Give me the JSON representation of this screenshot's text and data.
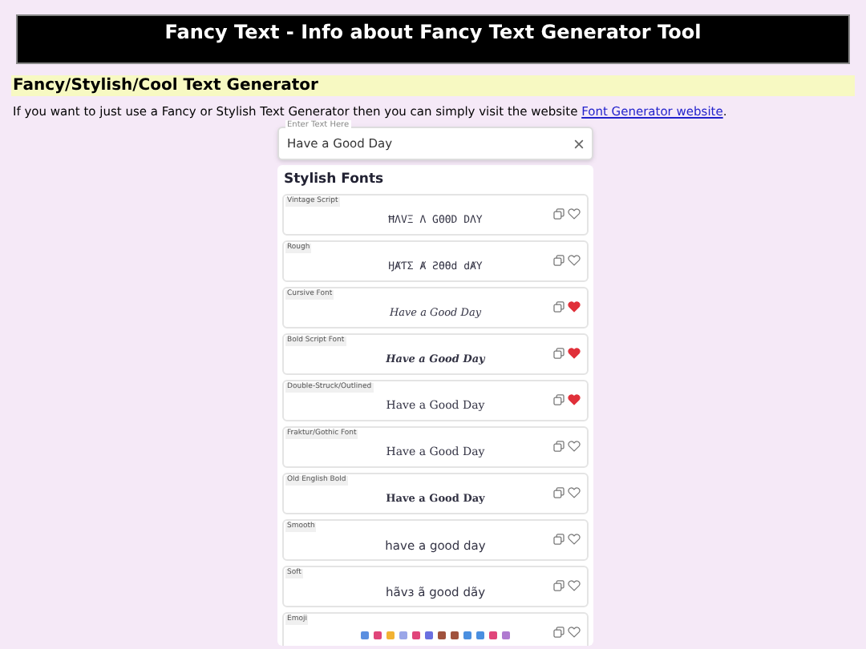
{
  "banner": {
    "title": "Fancy Text - Info about Fancy Text Generator Tool"
  },
  "heading": "Fancy/Stylish/Cool Text Generator",
  "intro": {
    "text": "If you want to just use a Fancy or Stylish Text Generator then you can simply visit the website ",
    "link": "Font Generator website",
    "after": "."
  },
  "input": {
    "label": "Enter Text Here",
    "value": "Have a Good Day"
  },
  "section_title": "Stylish Fonts",
  "fonts": [
    {
      "name": "Vintage Script",
      "kind": "caps",
      "sample": "ĦΛVΞ Λ GΘΘD DΛY",
      "favorite": false
    },
    {
      "name": "Rough",
      "kind": "caps",
      "sample": "ӇȺƬΣ Ⱥ ƧӨӨd dȺY",
      "favorite": false
    },
    {
      "name": "Cursive Font",
      "kind": "italic",
      "sample": "Have a Good Day",
      "favorite": true
    },
    {
      "name": "Bold Script Font",
      "kind": "bolditalic",
      "sample": "Have a Good Day",
      "favorite": true
    },
    {
      "name": "Double-Struck/Outlined",
      "kind": "serif",
      "sample": "Have a Good Day",
      "favorite": true
    },
    {
      "name": "Fraktur/Gothic Font",
      "kind": "serif",
      "sample": "Have a Good Day",
      "favorite": false
    },
    {
      "name": "Old English Bold",
      "kind": "boldserif",
      "sample": "Have a Good Day",
      "favorite": false
    },
    {
      "name": "Smooth",
      "kind": "plain",
      "sample": "have a good day",
      "favorite": false
    },
    {
      "name": "Soft",
      "kind": "plain",
      "sample": "hãvɜ ã good dãy",
      "favorite": false
    },
    {
      "name": "Emoji",
      "kind": "emoji",
      "emojis": [
        {
          "color": "#5b8fe0"
        },
        {
          "color": "#e0457a"
        },
        {
          "color": "#f2b233"
        },
        {
          "color": "#9aa6e8"
        },
        {
          "color": "#e0457a"
        },
        {
          "color": "#6a6fe0"
        },
        {
          "color": "#a0523d"
        },
        {
          "color": "#a0523d"
        },
        {
          "color": "#4a8fe0"
        },
        {
          "color": "#4a8fe0"
        },
        {
          "color": "#e0457a"
        },
        {
          "color": "#b07ad0"
        }
      ],
      "favorite": false
    }
  ]
}
